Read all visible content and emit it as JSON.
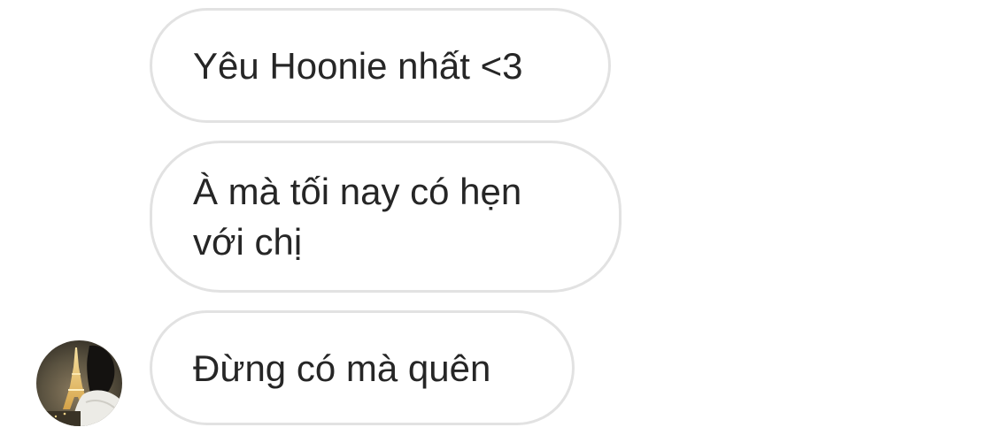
{
  "messages": [
    {
      "text": "Yêu Hoonie nhất <3"
    },
    {
      "text": "À mà tối nay có hẹn với chị"
    },
    {
      "text": "Đừng có mà quên"
    }
  ],
  "avatar": {
    "icon": "profile-photo-eiffel-tower"
  },
  "colors": {
    "bubble_border": "#e2e2e2",
    "text": "#262626",
    "background": "#ffffff"
  }
}
